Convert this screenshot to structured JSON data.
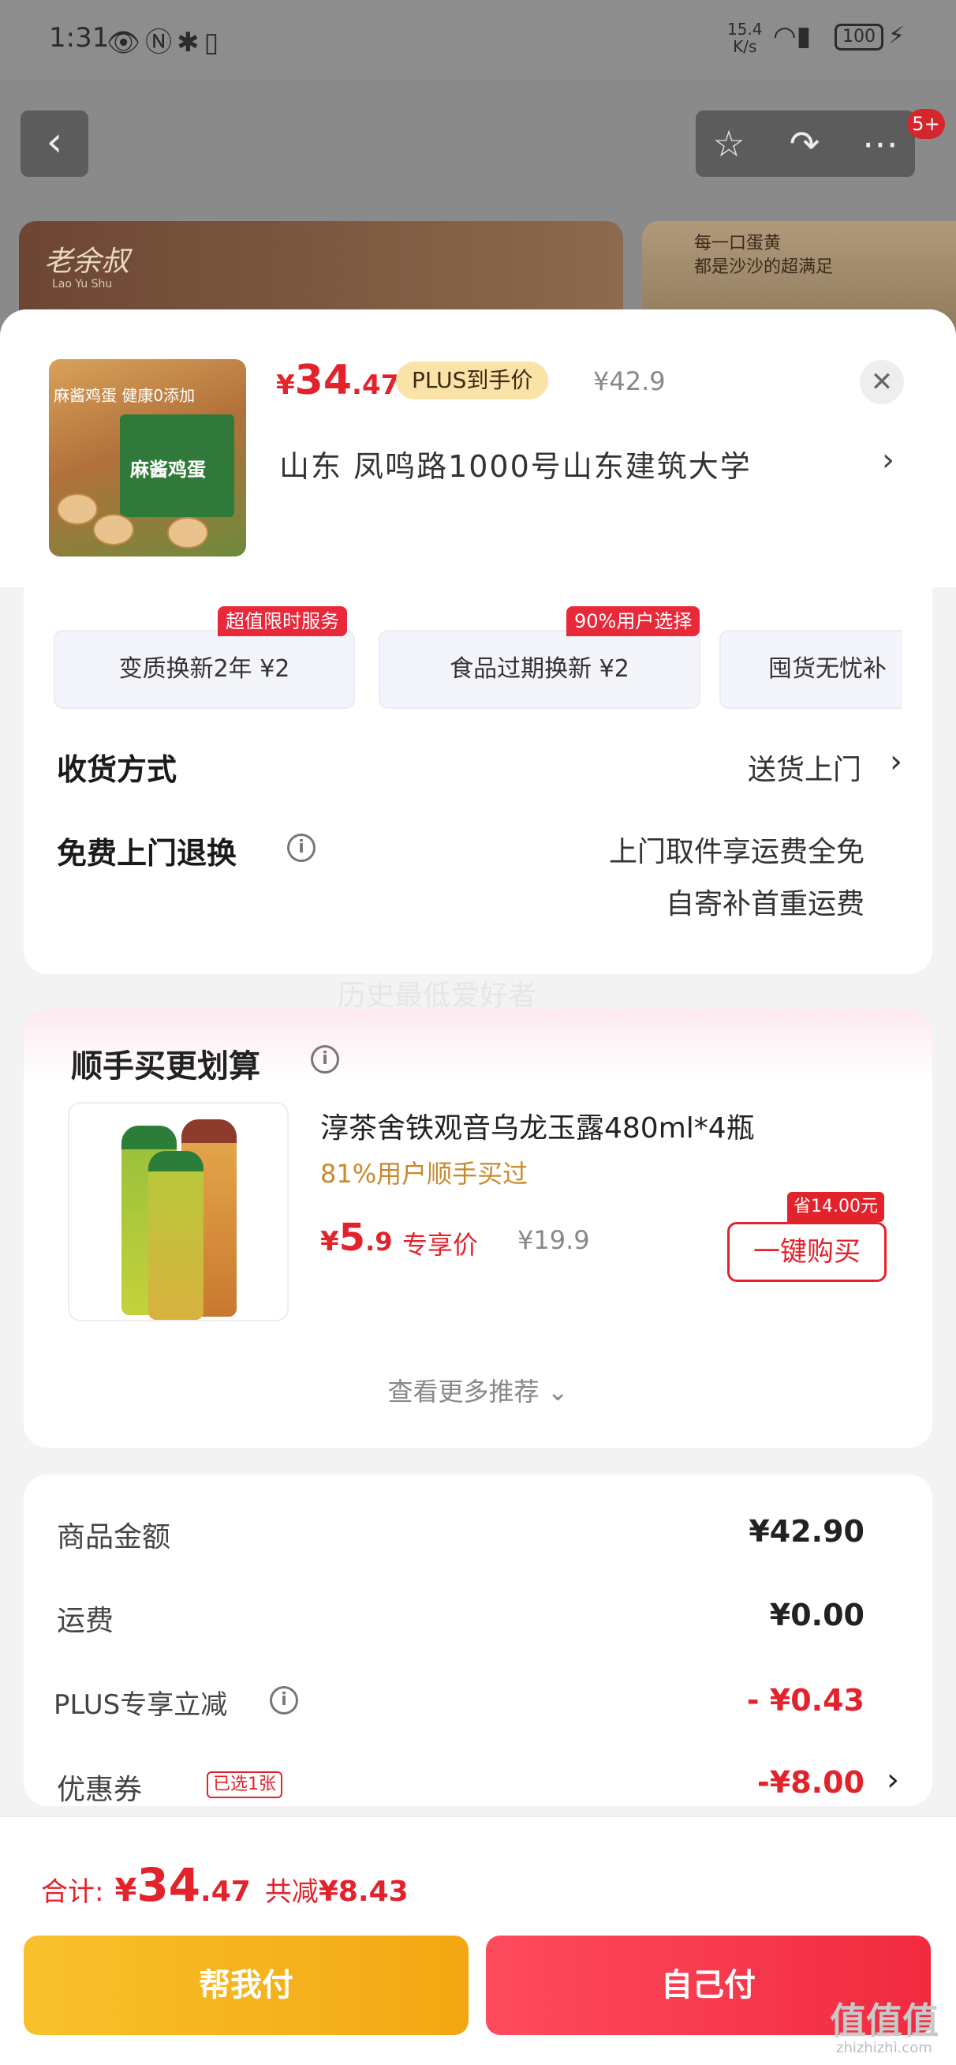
{
  "status_bar": {
    "time": "1:31",
    "net_speed_value": "15.4",
    "net_speed_unit": "K/s",
    "battery": "100"
  },
  "nav": {
    "badge": "5+"
  },
  "background": {
    "brand_logo": "老余叔",
    "brand_logo_sub": "Lao Yu Shu",
    "banner_text_line1": "每一口蛋黄",
    "banner_text_line2": "都是沙沙的超满足"
  },
  "sheet": {
    "product": {
      "thumb_top_text": "麻酱鸡蛋  健康0添加",
      "thumb_box_label": "麻酱鸡蛋",
      "price_yen": "¥",
      "price_main": "34",
      "price_decimal": ".47",
      "plus_tag": "PLUS到手价",
      "original_price": "¥42.9"
    },
    "address": "山东   凤鸣路1000号山东建筑大学",
    "services": [
      {
        "label": "变质换新2年   ¥2",
        "badge": "超值限时服务"
      },
      {
        "label": "食品过期换新   ¥2",
        "badge": "90%用户选择"
      },
      {
        "label": "囤货无忧补",
        "badge": ""
      }
    ],
    "delivery": {
      "label": "收货方式",
      "value": "送货上门"
    },
    "return": {
      "label": "免费上门退换",
      "line1": "上门取件享运费全免",
      "line2": "自寄补首重运费"
    },
    "watermark": "历史最低爱好者"
  },
  "recommend": {
    "title": "顺手买更划算",
    "item": {
      "name": "淳茶舍铁观音乌龙玉露480ml*4瓶",
      "subtitle": "81%用户顺手买过",
      "price_yen": "¥",
      "price_main": "5",
      "price_decimal": ".9",
      "exclusive": "专享价",
      "original_price": "¥19.9",
      "save_tag": "省14.00元",
      "buy_label": "一键购买"
    },
    "more": "查看更多推荐"
  },
  "summary": {
    "rows": [
      {
        "label": "商品金额",
        "value": "¥42.90"
      },
      {
        "label": "运费",
        "value": "¥0.00"
      },
      {
        "label": "PLUS专享立减",
        "value": "- ¥0.43"
      },
      {
        "label": "优惠券",
        "value": "-¥8.00",
        "tag": "已选1张"
      }
    ]
  },
  "footer": {
    "total_label": "合计:",
    "total_yen": "¥",
    "total_main": "34",
    "total_decimal": ".47",
    "discount_label": "共减",
    "discount_value": "¥8.43",
    "help_pay": "帮我付",
    "self_pay": "自己付"
  },
  "corner_mark": {
    "text": "值值值",
    "sub": "zhizhizhi.com"
  },
  "colors": {
    "accent_red": "#e3232c",
    "help_yellow": "#f8c12b",
    "pay_red": "#f12a3f"
  }
}
